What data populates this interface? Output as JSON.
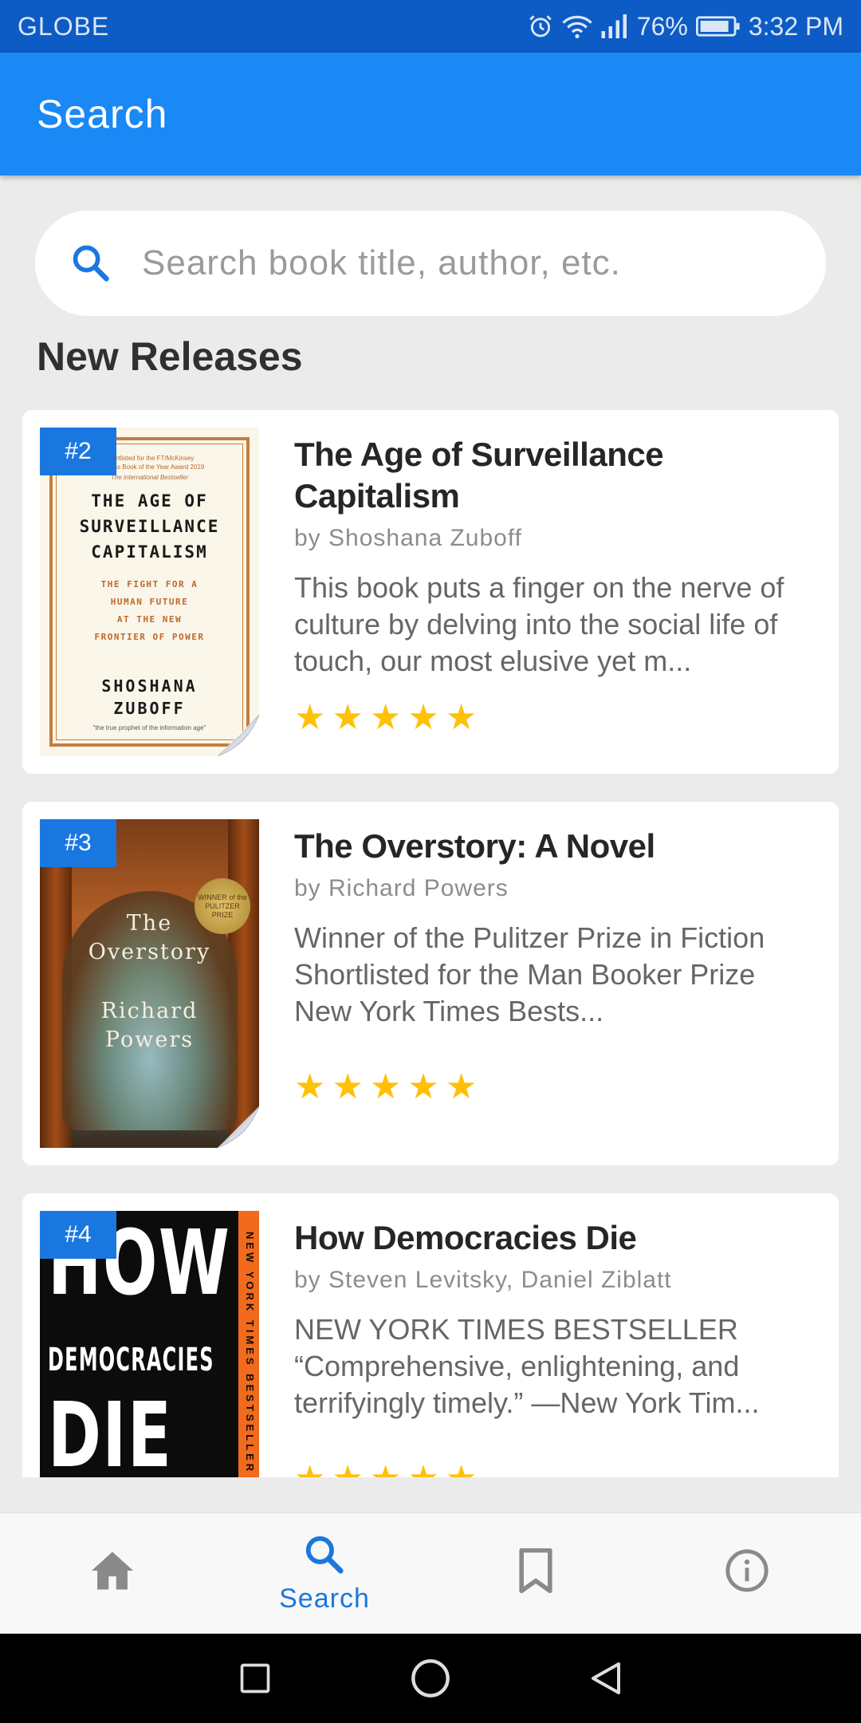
{
  "status_bar": {
    "carrier": "GLOBE",
    "battery": "76%",
    "time": "3:32 PM",
    "icons": [
      "alarm-icon",
      "wifi-icon",
      "signal-icon",
      "battery-icon"
    ]
  },
  "app_bar": {
    "title": "Search"
  },
  "search": {
    "placeholder": "Search book title, author, etc.",
    "icon": "search-icon"
  },
  "section": {
    "title": "New Releases"
  },
  "books": [
    {
      "rank": "#2",
      "title": "The Age of Surveillance Capitalism",
      "author": "by Shoshana Zuboff",
      "description": "This book puts a finger on the nerve of culture by delving into the social life of touch, our most elusive yet m...",
      "rating": 5,
      "cover": {
        "top_small_1": "Shortlisted for the FT/McKinsey",
        "top_small_2": "Business Book of the Year Award 2019",
        "top_small_3": "The international Bestseller",
        "title_lines": [
          "THE AGE OF",
          "SURVEILLANCE",
          "CAPITALISM"
        ],
        "subtitle_lines": [
          "THE FIGHT FOR A",
          "HUMAN FUTURE",
          "AT THE NEW",
          "FRONTIER OF POWER"
        ],
        "author_lines": [
          "SHOSHANA",
          "ZUBOFF"
        ],
        "quote": "\"the true prophet of the information age\""
      }
    },
    {
      "rank": "#3",
      "title": "The Overstory: A Novel",
      "author": "by Richard Powers",
      "description": "Winner of the Pulitzer Prize in Fiction Shortlisted for the Man Booker Prize New York Times Bests...",
      "rating": 5,
      "cover": {
        "title_lines": [
          "The",
          "Overstory"
        ],
        "author_lines": [
          "Richard",
          "Powers"
        ],
        "badge": "WINNER of the PULITZER PRIZE"
      }
    },
    {
      "rank": "#4",
      "title": "How Democracies Die",
      "author": "by Steven Levitsky, Daniel Ziblatt",
      "description": "NEW YORK TIMES BESTSELLER “Comprehensive, enlightening, and terrifyingly timely.” —New York Tim...",
      "rating": 5,
      "cover": {
        "line_1": "HOW",
        "line_2": "DEMOCRACIES",
        "line_3": "DIE",
        "stripe": "NEW YORK TIMES BESTSELLER"
      }
    }
  ],
  "bottom_nav": {
    "items": [
      {
        "id": "home",
        "icon": "home-icon",
        "label": ""
      },
      {
        "id": "search",
        "icon": "search-icon",
        "label": "Search"
      },
      {
        "id": "bookmarks",
        "icon": "bookmark-icon",
        "label": ""
      },
      {
        "id": "about",
        "icon": "info-icon",
        "label": ""
      }
    ],
    "active": "search",
    "active_color": "#1a77e0",
    "inactive_color": "#8a8a8a"
  },
  "colors": {
    "app_bar": "#1a88f5",
    "status_bar": "#0d5bc4",
    "star": "#ffc107",
    "rank_badge": "#1a77e0"
  }
}
